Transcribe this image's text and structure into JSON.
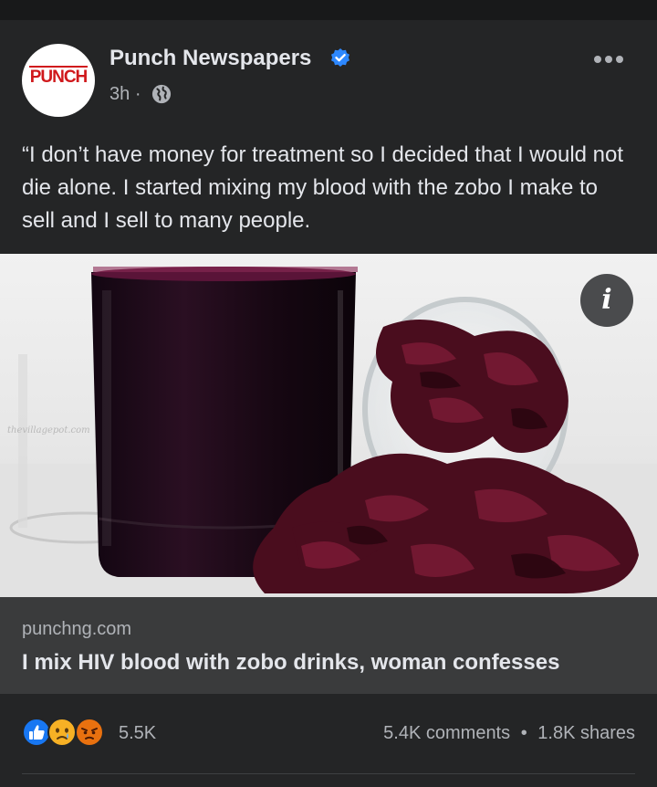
{
  "post": {
    "page_name": "Punch Newspapers",
    "avatar_text": "PUNCH",
    "time": "3h",
    "separator": "·",
    "caption": "“I don’t have money for treatment so I decided that I would not die alone. I started mixing my blood with the zobo I make to sell and I sell to many people.",
    "image": {
      "watermark": "thevillagepot.com",
      "info_label": "i"
    },
    "link": {
      "domain": "punchng.com",
      "headline": "I mix HIV blood with zobo drinks, woman confesses"
    },
    "reactions": {
      "icons": [
        "like-icon",
        "sad-icon",
        "angry-icon"
      ],
      "count": "5.5K"
    },
    "stats": {
      "comments": "5.4K comments",
      "dot": "•",
      "shares": "1.8K shares"
    },
    "colors": {
      "background": "#18191a",
      "card": "#242526",
      "link_card": "#3a3b3c",
      "verified": "#2d88ff",
      "like": "#1877f2",
      "angry": "#e9710f",
      "sad": "#f7b125"
    }
  }
}
